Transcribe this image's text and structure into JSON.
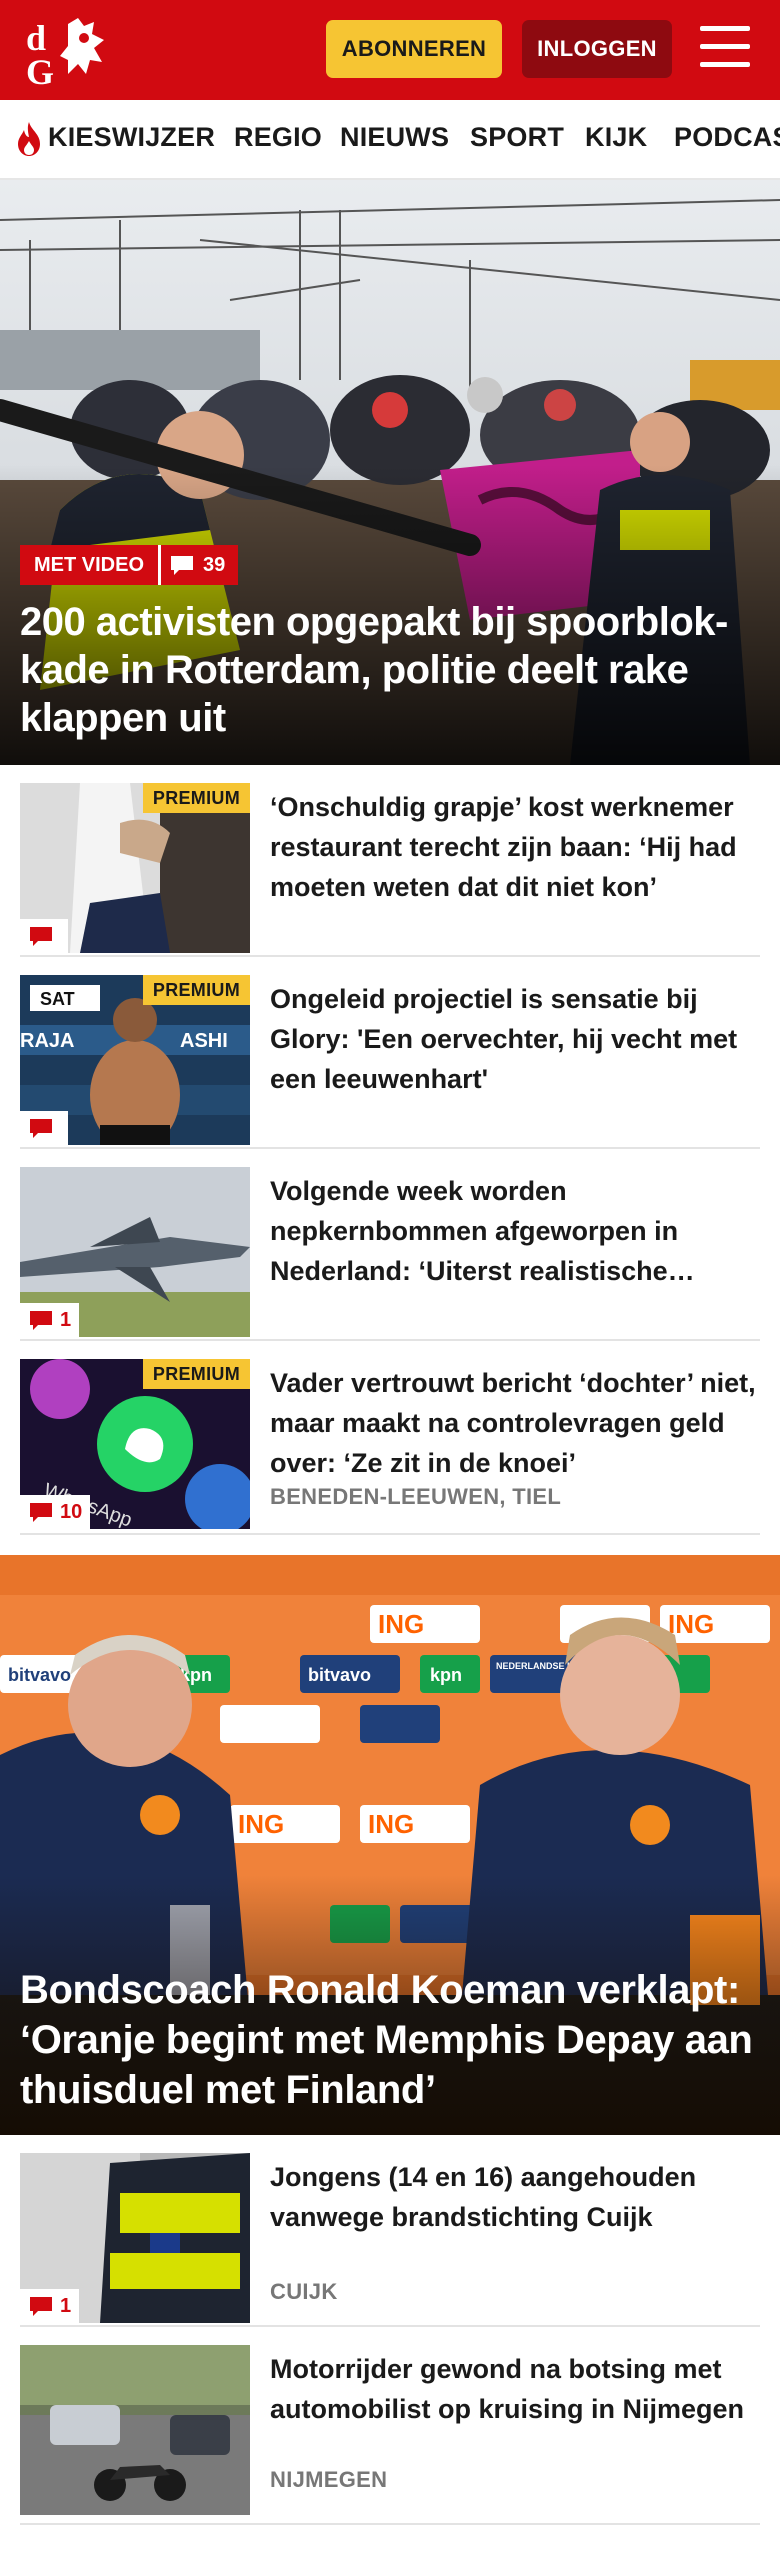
{
  "header": {
    "logo_text": "dG",
    "subscribe_label": "ABONNEREN",
    "login_label": "INLOGGEN",
    "menu_icon": "hamburger-menu-icon",
    "brand_color": "#d10a11",
    "accent_color": "#f6c533"
  },
  "nav": {
    "items": [
      "KIESWIJZER",
      "REGIO",
      "NIEUWS",
      "SPORT",
      "KIJK",
      "PODCAST"
    ]
  },
  "hero": {
    "badge": "MET VIDEO",
    "comments": "39",
    "title": "200 activisten opgepakt bij spoorblok­kade in Rotterdam, politie deelt rake klappen uit"
  },
  "articles": [
    {
      "premium": "PREMIUM",
      "comments": "",
      "title": "‘Onschuldig grapje’ kost werknemer restaurant terecht zijn baan: ‘Hij had moeten weten dat dit niet kon’",
      "location": ""
    },
    {
      "premium": "PREMIUM",
      "comments": "",
      "title": "Ongeleid projectiel is sensatie bij Glory: 'Een oervechter, hij vecht met een leeuwenhart'",
      "location": ""
    },
    {
      "premium": "",
      "comments": "1",
      "title": "Volgende week worden nepkernbommen afgeworpen in Nederland: ‘Uiterst realistische oefening’",
      "location": ""
    },
    {
      "premium": "PREMIUM",
      "comments": "10",
      "title": "Vader vertrouwt bericht ‘dochter’ niet, maar maakt na controlevragen geld over: ‘Ze zit in de knoei’",
      "location": "BENEDEN-LEEUWEN, TIEL"
    }
  ],
  "big_story": {
    "title": "Bondscoach Ronald Koeman verklapt: ‘Oranje begint met Memphis Depay aan thuisduel met Finland’",
    "banner_words": [
      "ING",
      "kpn",
      "bitvavo",
      "NEDERLANDSE LOTERIJ"
    ]
  },
  "articles2": [
    {
      "comments": "1",
      "title": "Jongens (14 en 16) aangehouden vanwege brandstichting Cuijk",
      "location": "CUIJK"
    },
    {
      "comments": "",
      "title": "Motorrijder gewond na botsing met automobilist op kruising in Nijmegen",
      "location": "NIJMEGEN"
    }
  ]
}
